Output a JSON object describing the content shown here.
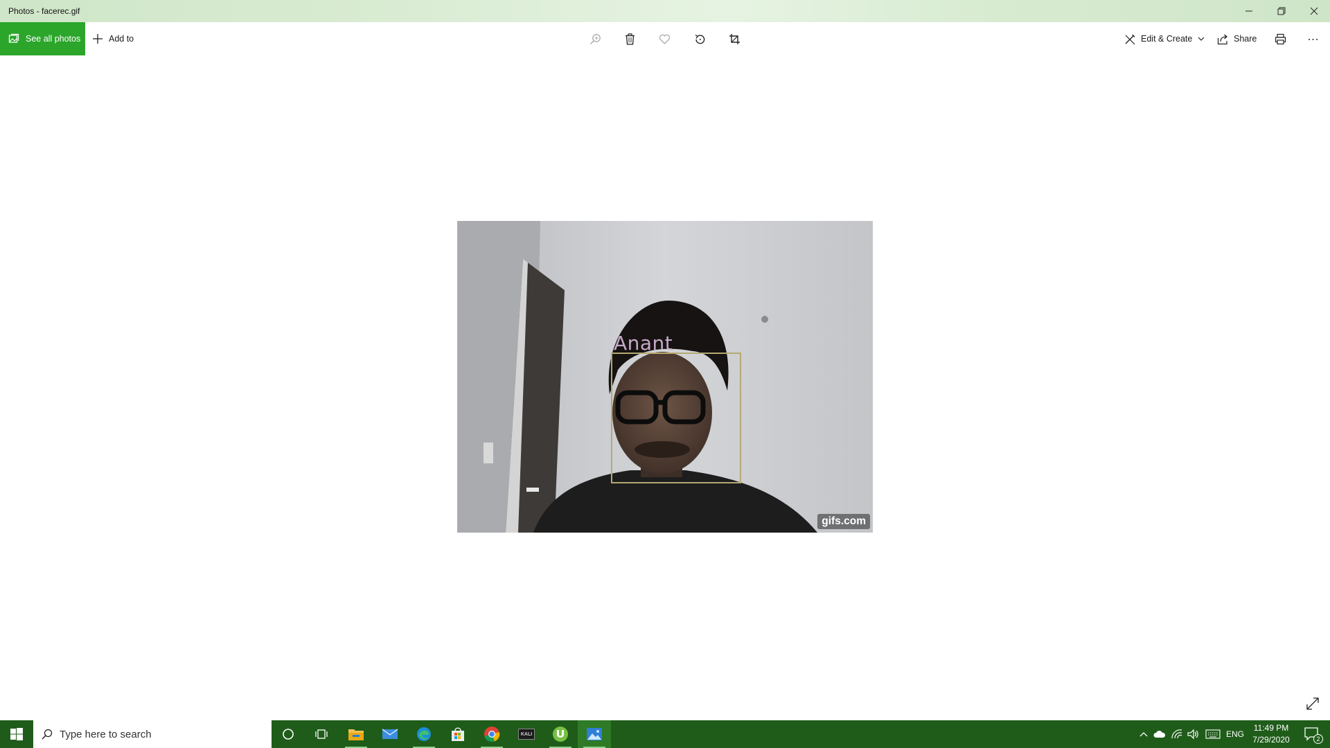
{
  "window": {
    "title": "Photos - facerec.gif"
  },
  "toolbar": {
    "see_all_label": "See all photos",
    "add_to_label": "Add to",
    "edit_create_label": "Edit & Create",
    "share_label": "Share"
  },
  "photo": {
    "face_label": "Anant",
    "watermark": "gifs.com"
  },
  "taskbar": {
    "search_placeholder": "Type here to search",
    "kali_label": "KALI",
    "language": "ENG",
    "time": "11:49 PM",
    "date": "7/29/2020",
    "notification_count": "2"
  },
  "colors": {
    "accent": "#2ba62b",
    "taskbar": "#1f5c1a",
    "titlebar": "#d9ecd3"
  }
}
